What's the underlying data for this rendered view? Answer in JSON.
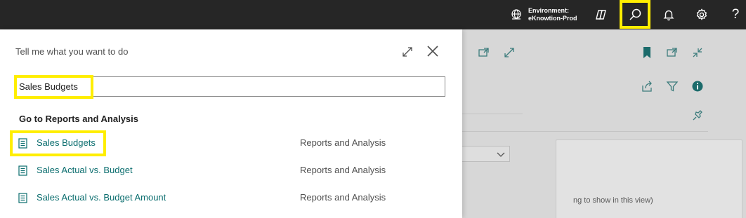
{
  "topbar": {
    "environment_label": "Environment:",
    "environment_name": "eKnowtion-Prod",
    "icons": [
      "globe-icon",
      "copilot-icon",
      "search-icon",
      "bell-icon",
      "gear-icon",
      "help-icon"
    ],
    "help_glyph": "?"
  },
  "dialog": {
    "title": "Tell me what you want to do",
    "search": {
      "value": "Sales Budgets"
    },
    "section_title": "Go to Reports and Analysis",
    "results": [
      {
        "label": "Sales Budgets",
        "category": "Reports and Analysis"
      },
      {
        "label": "Sales Actual vs. Budget",
        "category": "Reports and Analysis"
      },
      {
        "label": "Sales Actual vs. Budget Amount",
        "category": "Reports and Analysis"
      }
    ]
  },
  "background": {
    "empty_text": "ng to show in this view)"
  },
  "colors": {
    "topbar": "#262626",
    "highlight": "#ffee00",
    "link": "#0a6d6e",
    "accent": "#1b6b6b"
  }
}
